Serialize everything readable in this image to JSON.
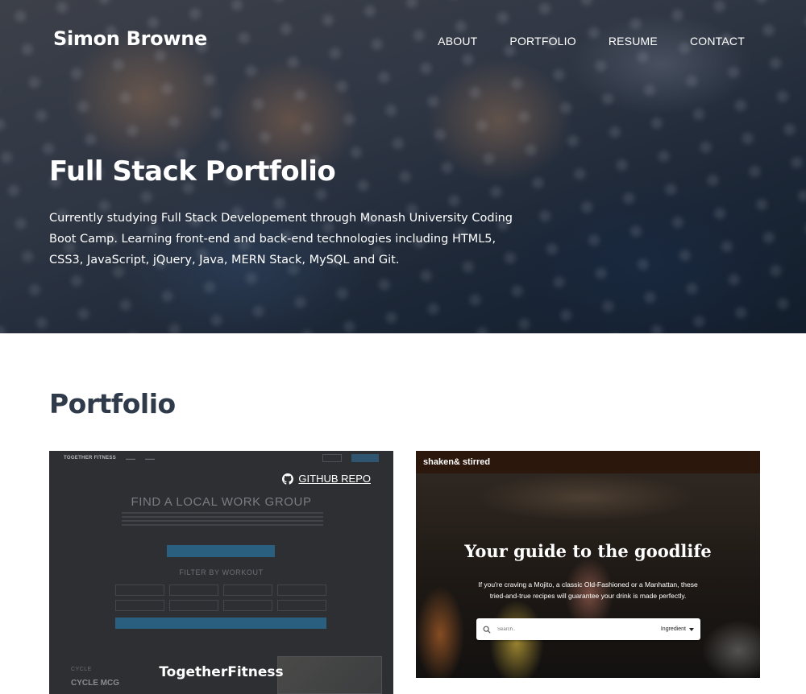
{
  "header": {
    "brand": "Simon Browne",
    "nav": [
      "ABOUT",
      "PORTFOLIO",
      "RESUME",
      "CONTACT"
    ]
  },
  "hero": {
    "title": "Full Stack Portfolio",
    "text": "Currently studying Full Stack Developement through Monash University Coding Boot Camp. Learning front-end and back-end technologies including HTML5, CSS3, JavaScript, jQuery, Java, MERN Stack, MySQL and Git."
  },
  "portfolio": {
    "title": "Portfolio",
    "projects": [
      {
        "name": "TogetherFitness",
        "repo_label": "GITHUB REPO",
        "preview": {
          "logo": "TOGETHER FITNESS",
          "heading": "FIND A LOCAL WORK GROUP",
          "filter_label": "FILTER BY WORKOUT",
          "cycle_label": "CYCLE",
          "cycle_value": "CYCLE MCG"
        }
      },
      {
        "name": "shaken & stirred",
        "preview": {
          "brand": "shaken& stirred",
          "title": "Your guide to the goodlife",
          "subtitle": "If you're craving a Mojito, a classic Old-Fashioned or a Manhattan, these tried-and-true recipes will guarantee your drink is made perfectly.",
          "search_placeholder": "Search..",
          "select_value": "Ingredient"
        }
      }
    ]
  },
  "icons": {
    "repo": "github-icon",
    "search": "search-icon",
    "select": "chevron-down-icon"
  }
}
